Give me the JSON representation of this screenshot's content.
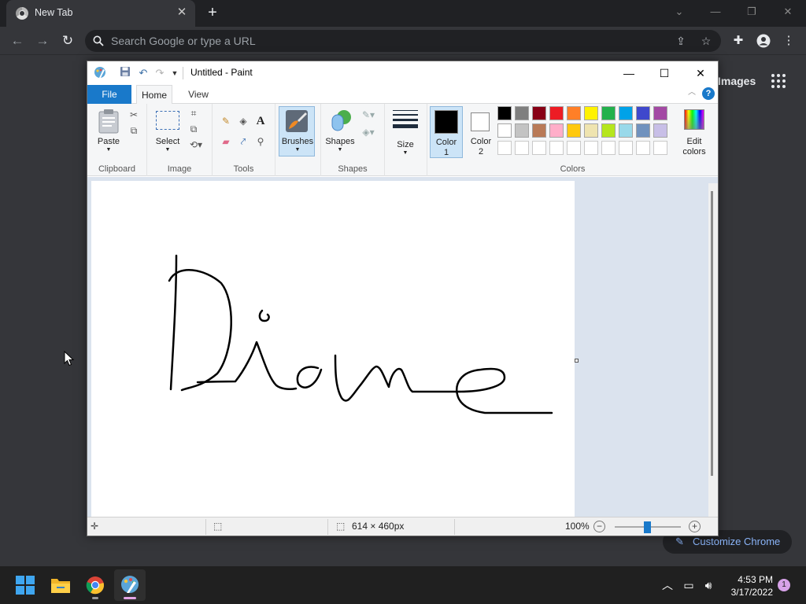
{
  "chrome": {
    "tab_title": "New Tab",
    "omnibox_placeholder": "Search Google or type a URL",
    "images_link": "Images",
    "customize_label": "Customize Chrome"
  },
  "paint": {
    "window_title": "Untitled - Paint",
    "tabs": {
      "file": "File",
      "home": "Home",
      "view": "View"
    },
    "groups": {
      "clipboard": "Clipboard",
      "image": "Image",
      "tools": "Tools",
      "shapes": "Shapes",
      "colors": "Colors"
    },
    "buttons": {
      "paste": "Paste",
      "select": "Select",
      "brushes": "Brushes",
      "shapes": "Shapes",
      "size": "Size",
      "color1_line1": "Color",
      "color1_line2": "1",
      "color2_line1": "Color",
      "color2_line2": "2",
      "edit_colors_line1": "Edit",
      "edit_colors_line2": "colors"
    },
    "palette_row1": [
      "#000000",
      "#7f7f7f",
      "#880015",
      "#ed1c24",
      "#ff7f27",
      "#fff200",
      "#22b14c",
      "#00a2e8",
      "#3f48cc",
      "#a349a4"
    ],
    "palette_row2": [
      "#ffffff",
      "#c3c3c3",
      "#b97a57",
      "#ffaec9",
      "#ffc90e",
      "#efe4b0",
      "#b5e61d",
      "#99d9ea",
      "#7092be",
      "#c8bfe7"
    ],
    "color1": "#000000",
    "color2": "#ffffff",
    "status": {
      "canvas_size": "614 × 460px",
      "zoom": "100%"
    }
  },
  "taskbar": {
    "time": "4:53 PM",
    "date": "3/17/2022",
    "notifications": "1"
  }
}
